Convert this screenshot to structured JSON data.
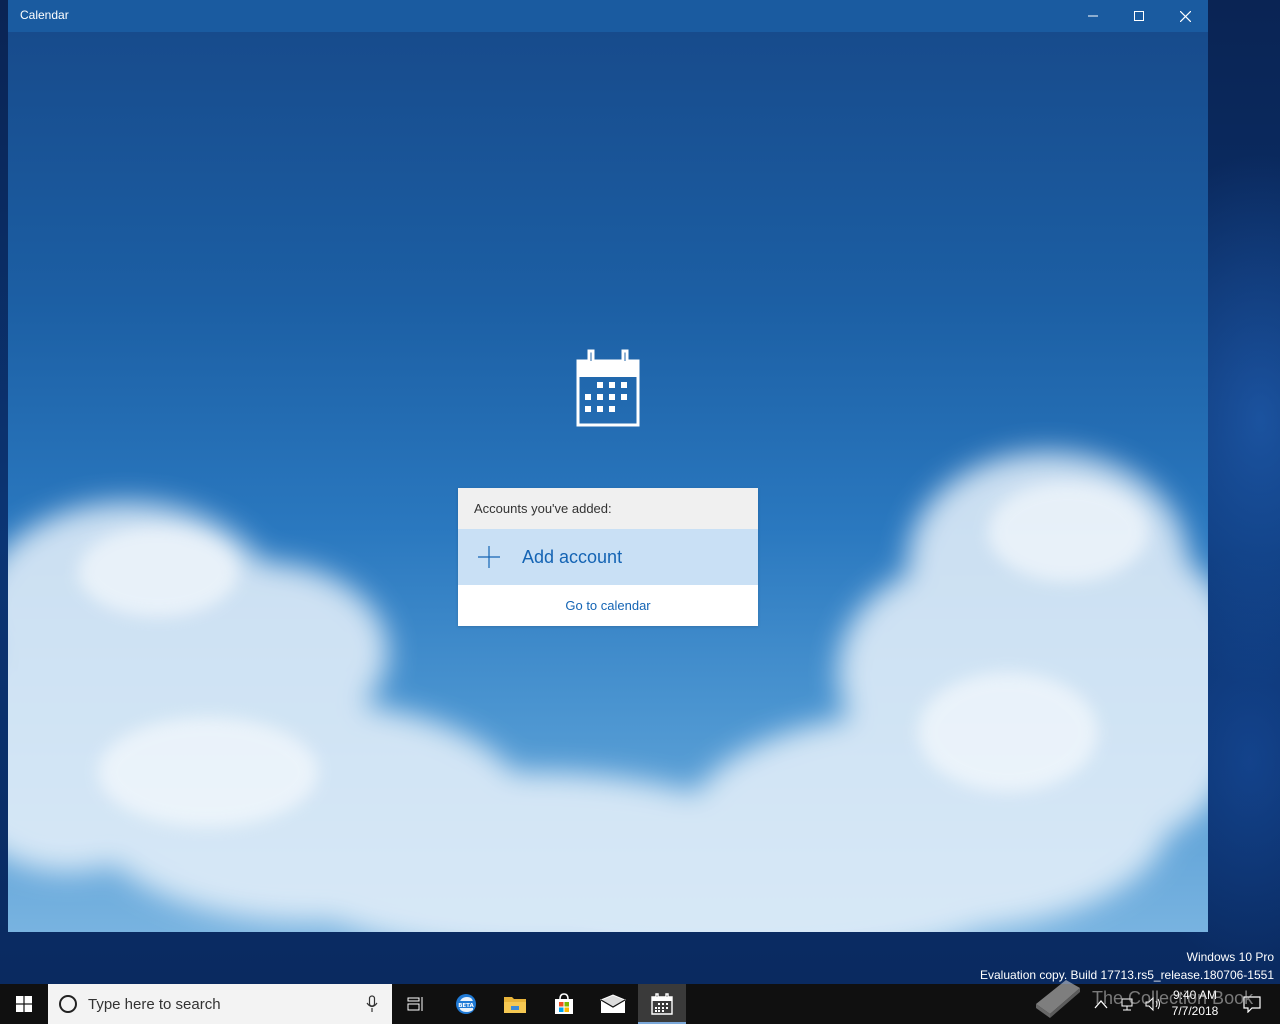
{
  "window": {
    "title": "Calendar",
    "controls": [
      "minimize-icon",
      "maximize-icon",
      "close-icon"
    ]
  },
  "welcome": {
    "logo_icon": "calendar-icon",
    "accounts_header": "Accounts you've added:",
    "add_account_label": "Add account",
    "add_account_icon": "plus-icon",
    "go_to_calendar": "Go to calendar"
  },
  "desktop_watermark": {
    "edition": "Windows 10 Pro",
    "build": "Evaluation copy. Build 17713.rs5_release.180706-1551"
  },
  "taskbar": {
    "search_placeholder": "Type here to search",
    "pinned": [
      "task-view-icon",
      "edge-beta-icon",
      "file-explorer-icon",
      "store-icon",
      "mail-icon",
      "calendar-icon"
    ],
    "active": "calendar-icon",
    "clock_time": "9:40 AM",
    "clock_date": "7/7/2018"
  },
  "overlay_brand": {
    "text": "The Collection Book"
  },
  "colors": {
    "accent": "#1464b4",
    "titlebar": "#1a5ba0",
    "add_account_bg": "#c9e0f5",
    "taskbar": "#101010"
  }
}
